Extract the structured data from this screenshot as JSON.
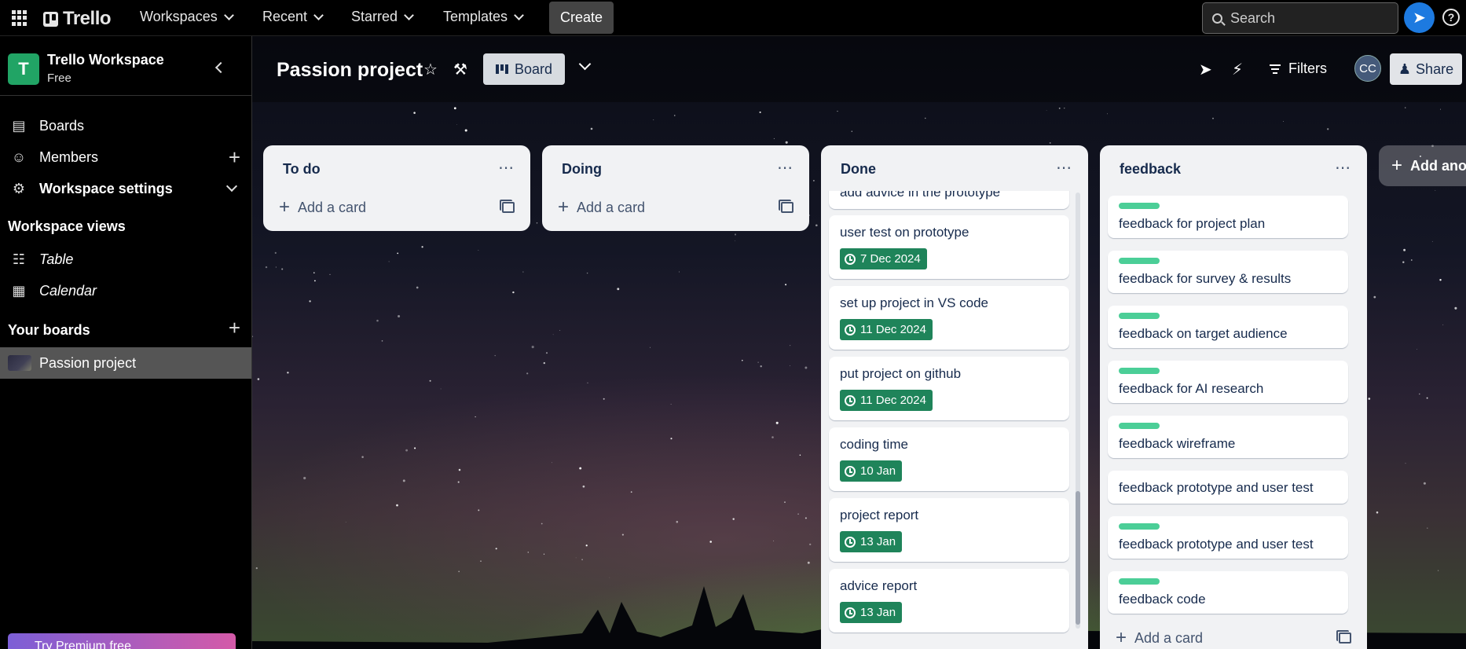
{
  "topbar": {
    "brand": "Trello",
    "nav": [
      "Workspaces",
      "Recent",
      "Starred",
      "Templates"
    ],
    "create": "Create",
    "search_placeholder": "Search"
  },
  "sidebar": {
    "workspace_initial": "T",
    "workspace_name": "Trello Workspace",
    "workspace_plan": "Free",
    "items": [
      {
        "label": "Boards",
        "icon": "trello-board-icon"
      },
      {
        "label": "Members",
        "icon": "person-icon"
      },
      {
        "label": "Workspace settings",
        "icon": "gear-icon"
      }
    ],
    "views_heading": "Workspace views",
    "views": [
      {
        "label": "Table",
        "icon": "table-icon"
      },
      {
        "label": "Calendar",
        "icon": "calendar-icon"
      }
    ],
    "boards_heading": "Your boards",
    "boards": [
      {
        "label": "Passion project"
      }
    ],
    "premium_text": "Try Premium free"
  },
  "board": {
    "title": "Passion project",
    "view": "Board",
    "filters": "Filters",
    "member_initials": "CC",
    "share": "Share",
    "add_list": "Add another list",
    "add_card": "Add a card"
  },
  "lists": [
    {
      "title": "To do",
      "cards": []
    },
    {
      "title": "Doing",
      "cards": []
    },
    {
      "title": "Done",
      "cards": [
        {
          "title": "add advice in the prototype"
        },
        {
          "title": "user test on prototype",
          "due": "7 Dec 2024"
        },
        {
          "title": "set up project in VS code",
          "due": "11 Dec 2024"
        },
        {
          "title": "put project on github",
          "due": "11 Dec 2024"
        },
        {
          "title": "coding time",
          "due": "10 Jan"
        },
        {
          "title": "project report",
          "due": "13 Jan"
        },
        {
          "title": "advice report",
          "due": "13 Jan"
        }
      ]
    },
    {
      "title": "feedback",
      "cards": [
        {
          "title": "feedback for project plan",
          "label": true
        },
        {
          "title": "feedback for survey & results",
          "label": true
        },
        {
          "title": "feedback on target audience",
          "label": true
        },
        {
          "title": "feedback for AI research",
          "label": true
        },
        {
          "title": "feedback wireframe",
          "label": true
        },
        {
          "title": "feedback prototype and user test",
          "label": false
        },
        {
          "title": "feedback prototype and user test",
          "label": true
        },
        {
          "title": "feedback code",
          "label": true
        }
      ]
    }
  ],
  "colors": {
    "workspace_avatar": "#21a465",
    "due_badge": "#1f845a",
    "card_label": "#4bce97",
    "notification_button": "#1d7ae0"
  }
}
